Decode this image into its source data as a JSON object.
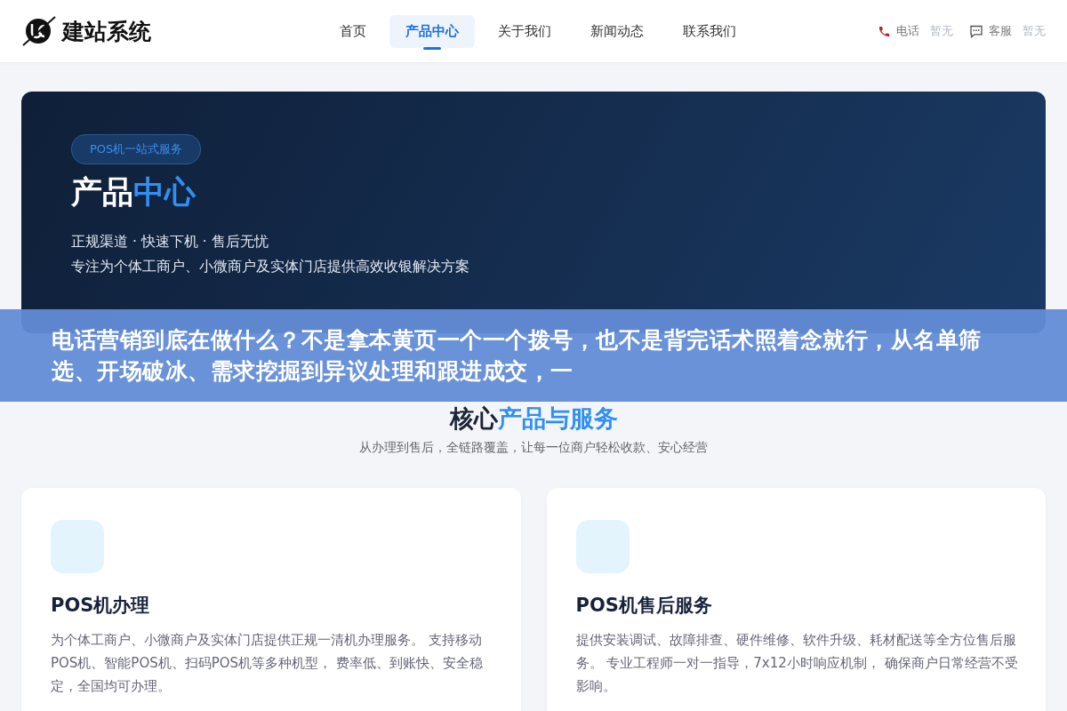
{
  "header": {
    "logo_text": "建站系统",
    "nav": [
      {
        "label": "首页",
        "selected": false
      },
      {
        "label": "产品中心",
        "selected": true
      },
      {
        "label": "关于我们",
        "selected": false
      },
      {
        "label": "新闻动态",
        "selected": false
      },
      {
        "label": "联系我们",
        "selected": false
      }
    ],
    "contacts": [
      {
        "kind": "phone",
        "label": "电话",
        "value": "暂无"
      },
      {
        "kind": "chat",
        "label": "客服",
        "value": "暂无"
      }
    ]
  },
  "hero": {
    "badge": "POS机一站式服务",
    "title": "产品",
    "title_accent": "中心",
    "tagline": "正规渠道 · 快速下机 · 售后无忧",
    "description": "专注为个体工商户、小微商户及实体门店提供高效收银解决方案"
  },
  "notice_banner": {
    "text": "电话营销到底在做什么？不是拿本黄页一个一个拨号，也不是背完话术照着念就行，从名单筛选、开场破冰、需求挖掘到异议处理和跟进成交，一"
  },
  "section": {
    "title": "核心",
    "title_accent": "产品与服务",
    "subtitle": "从办理到售后，全链路覆盖，让每一位商户轻松收款、安心经营"
  },
  "cards": [
    {
      "title": "POS机办理",
      "description": "为个体工商户、小微商户及实体门店提供正规一清机办理服务。 支持移动POS机、智能POS机、扫码POS机等多种机型， 费率低、到账快、安全稳定，全国均可办理。"
    },
    {
      "title": "POS机售后服务",
      "description": "提供安装调试、故障排查、硬件维修、软件升级、耗材配送等全方位售后服务。 专业工程师一对一指导，7x12小时响应机制， 确保商户日常经营不受影响。"
    }
  ]
}
